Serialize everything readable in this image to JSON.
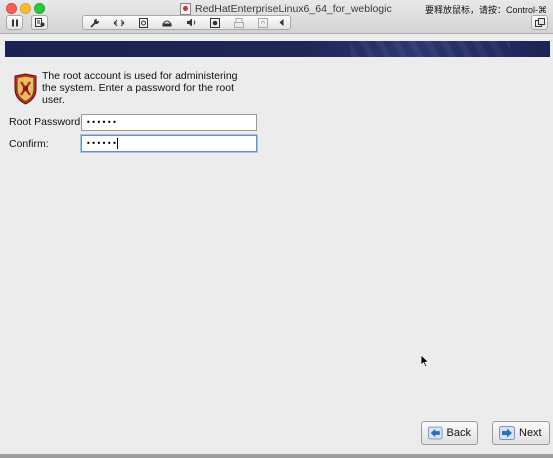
{
  "window": {
    "title": "RedHatEnterpriseLinux6_64_for_weblogic",
    "release_hint": "要释放鼠标，请按：Control-⌘"
  },
  "toolbar": {
    "icons": [
      "pause-icon",
      "vm-settings-icon",
      "wrench-icon",
      "network-arrows-icon",
      "hard-disk-icon",
      "cd-dvd-icon",
      "sound-icon",
      "camera-icon",
      "printer-icon",
      "usb-icon",
      "more-left-icon",
      "window-mode-icon"
    ]
  },
  "installer": {
    "description": "The root account is used for administering the system.  Enter a password for the root user.",
    "root_password_label": "Root Password:",
    "root_password_value": "••••••",
    "confirm_label": "Confirm:",
    "confirm_value": "••••••",
    "back_label": "Back",
    "next_label": "Next"
  },
  "colors": {
    "header_band": "#1f2758",
    "shield_red": "#c0392b",
    "arrow_blue": "#2f6fba"
  }
}
